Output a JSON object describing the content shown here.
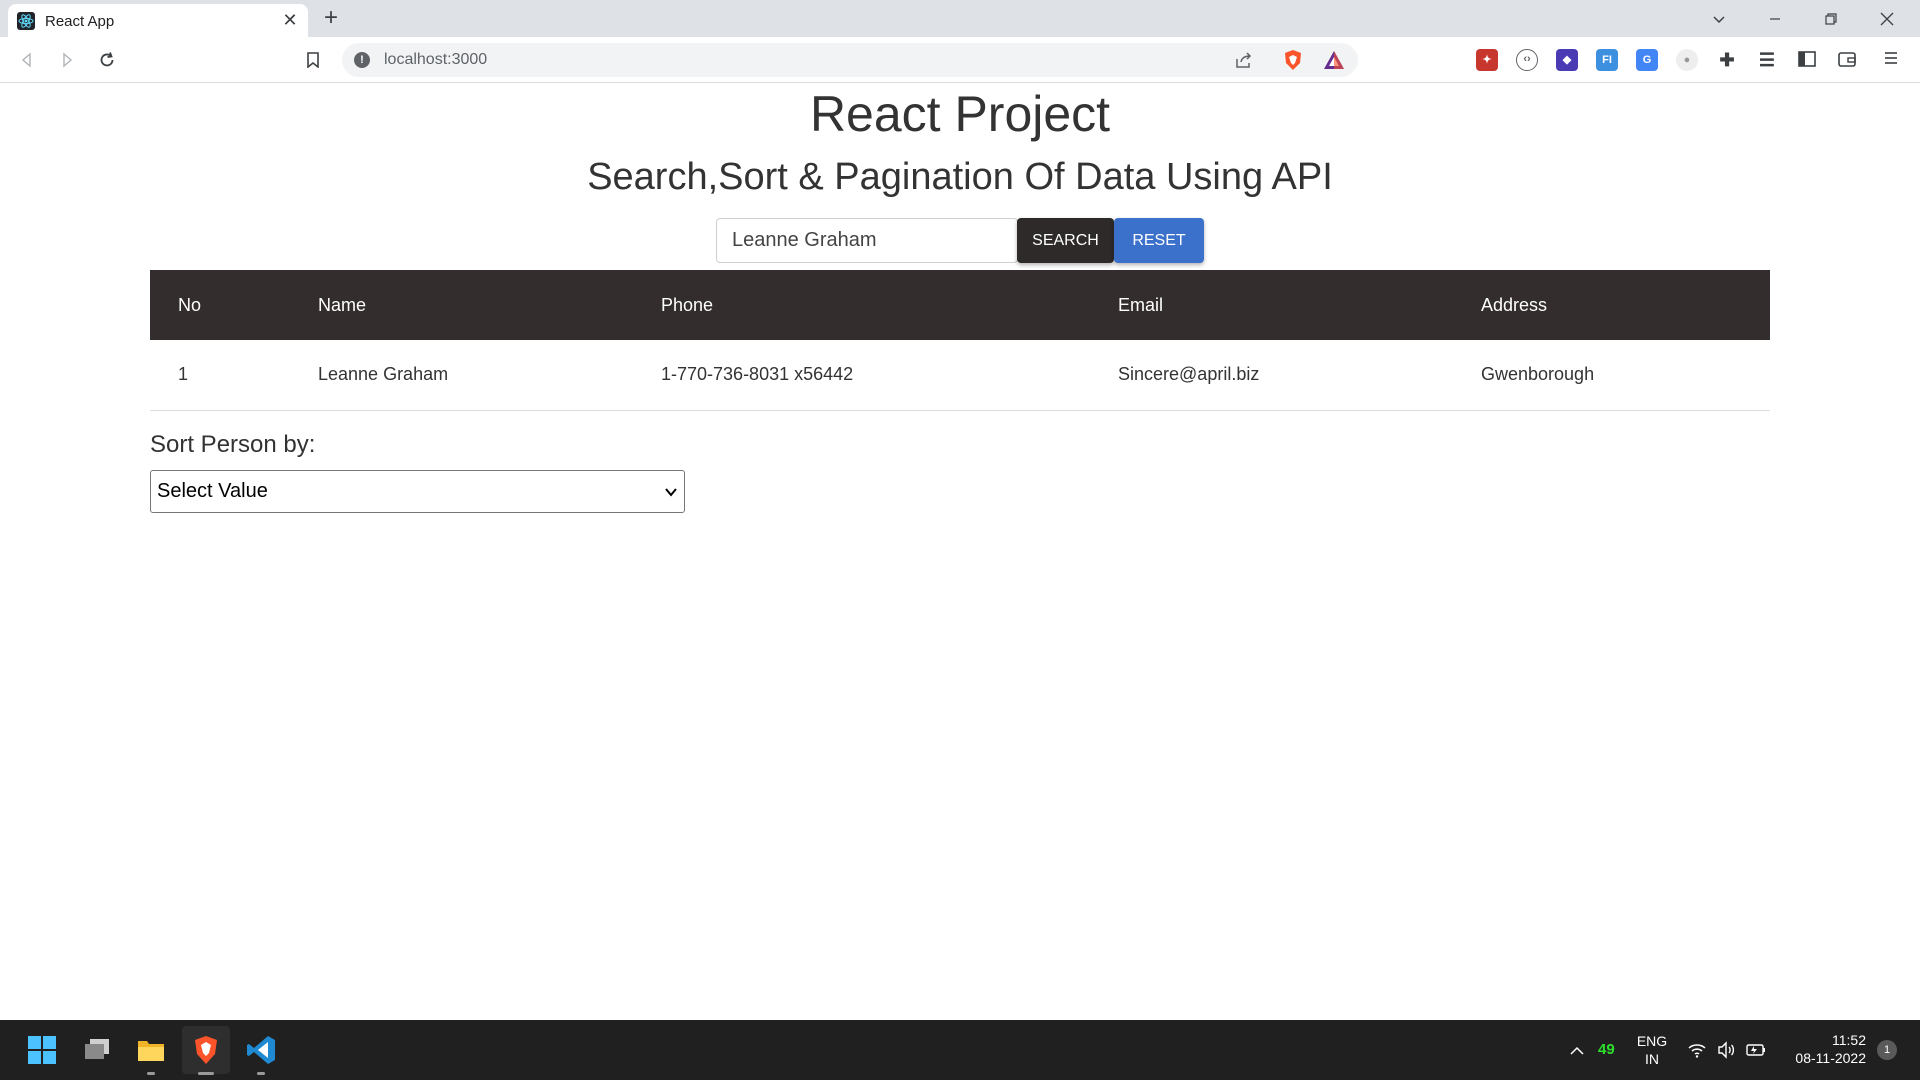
{
  "browser": {
    "tab_title": "React App",
    "url": "localhost:3000"
  },
  "page": {
    "title": "React Project",
    "subtitle": "Search,Sort & Pagination Of Data Using API",
    "search": {
      "value": "Leanne Graham",
      "search_label": "SEARCH",
      "reset_label": "RESET"
    },
    "table": {
      "headers": [
        "No",
        "Name",
        "Phone",
        "Email",
        "Address"
      ],
      "rows": [
        {
          "no": "1",
          "name": "Leanne Graham",
          "phone": "1-770-736-8031 x56442",
          "email": "Sincere@april.biz",
          "address": "Gwenborough"
        }
      ]
    },
    "sort": {
      "label": "Sort Person by:",
      "selected": "Select Value"
    }
  },
  "taskbar": {
    "tray_counter": "49",
    "language_line1": "ENG",
    "language_line2": "IN",
    "time": "11:52",
    "date": "08-11-2022",
    "notification_count": "1"
  },
  "colors": {
    "table_header_bg": "#332d2d",
    "search_button_bg": "#2e2a2a",
    "reset_button_bg": "#3b71ca"
  }
}
